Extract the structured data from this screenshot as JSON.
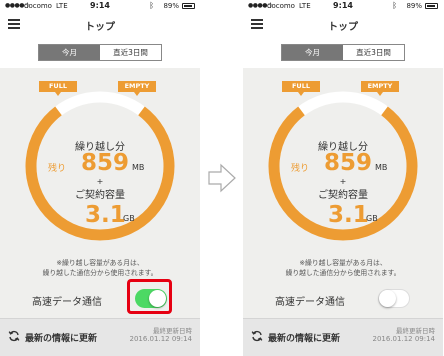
{
  "status_bar": {
    "signal": "●●●●○",
    "carrier": "docomo",
    "network": "LTE",
    "time": "9:14",
    "battery": "89%"
  },
  "nav": {
    "title": "トップ"
  },
  "tabs": [
    "今月",
    "直近3日間"
  ],
  "gauge": {
    "label_full": "FULL",
    "label_empty": "EMPTY",
    "carryover_label": "繰り越し分",
    "remaining_prefix": "残り",
    "remaining_value": "859",
    "remaining_unit": "MB",
    "plus": "+",
    "contract_label": "ご契約容量",
    "contract_value": "3.1",
    "contract_unit": "GB",
    "color": "#ed9c33",
    "track_color": "#ffffff"
  },
  "note_line1": "※繰り越し容量がある月は、",
  "note_line2": "繰り越した通信分から使用されます。",
  "high_speed": {
    "label": "高速データ通信",
    "left_state": "on",
    "right_state": "off"
  },
  "footer": {
    "refresh_label": "最新の情報に更新",
    "updated_label": "最終更新日時",
    "updated_value": "2016.01.12 09:14"
  }
}
